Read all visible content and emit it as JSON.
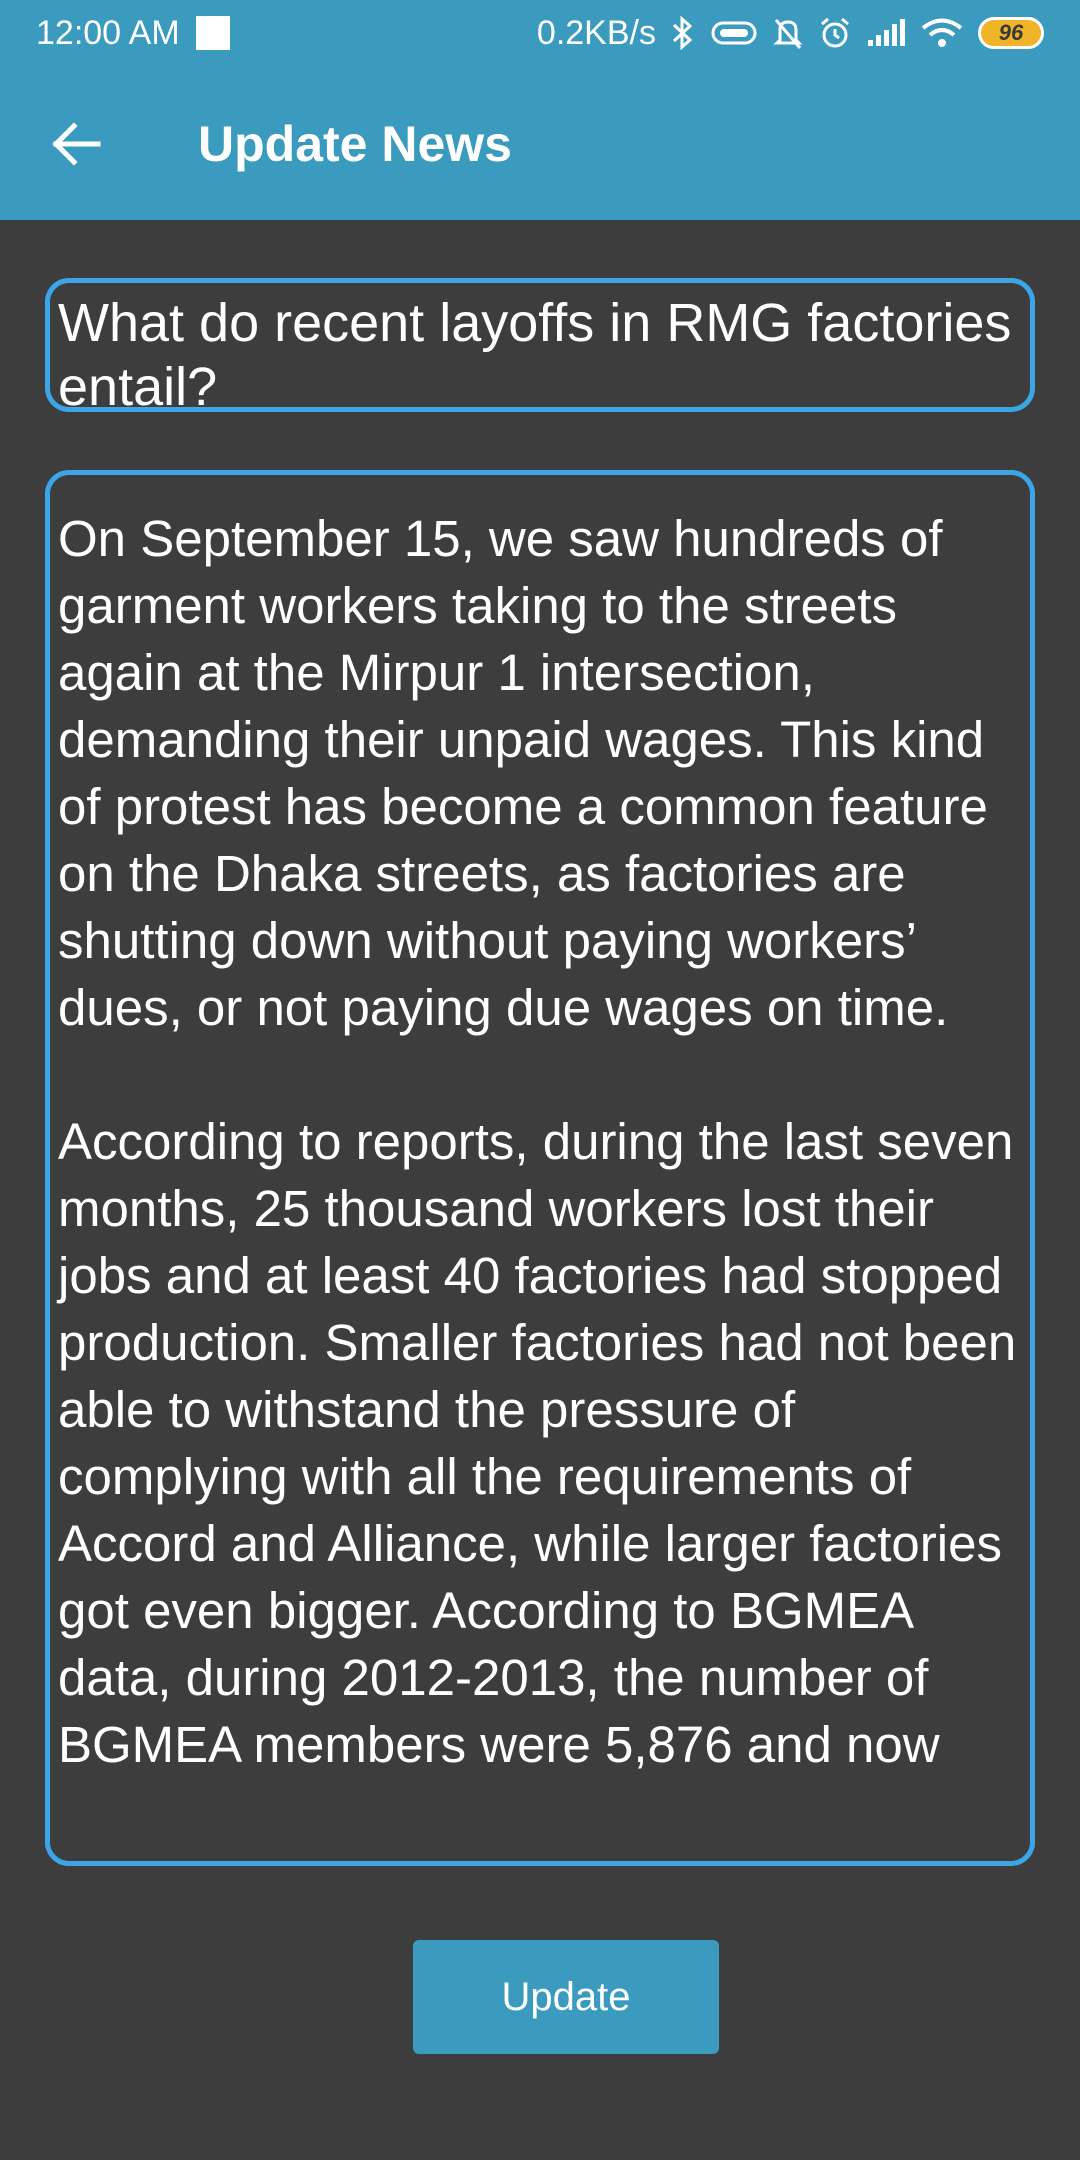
{
  "status_bar": {
    "time": "12:00 AM",
    "net_speed": "0.2KB/s",
    "battery": "96",
    "icons": [
      "notification-square-icon",
      "bluetooth-icon",
      "vibrate-icon",
      "mute-bell-icon",
      "alarm-icon",
      "signal-icon",
      "wifi-icon",
      "battery-icon"
    ]
  },
  "toolbar": {
    "back_icon": "arrow-left-icon",
    "title": "Update News"
  },
  "form": {
    "title_value": "What do recent layoffs in RMG factories entail?",
    "body_value": "On September 15, we saw hundreds of garment workers taking to the streets again at the Mirpur 1 intersection, demanding their unpaid wages. This kind of protest has become a common feature on the Dhaka streets, as factories are shutting down without paying workers’ dues, or not paying due wages on time.\n\nAccording to reports, during the last seven months, 25 thousand workers lost their jobs and at least 40 factories had stopped production. Smaller factories had not been able to withstand the pressure of complying with all the requirements of Accord and Alliance, while larger factories got even bigger. According to BGMEA data, during 2012-2013, the number of BGMEA members were 5,876 and now",
    "update_label": "Update"
  },
  "colors": {
    "primary": "#3a9bbf",
    "field_border": "#3aa6e8",
    "background": "#3d3d3d",
    "battery": "#f0b429"
  }
}
